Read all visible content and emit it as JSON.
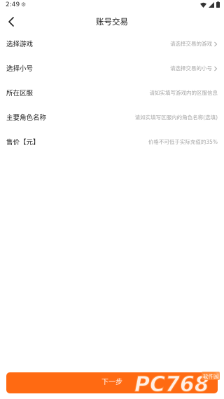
{
  "status": {
    "time": "2:49"
  },
  "header": {
    "title": "账号交易"
  },
  "rows": [
    {
      "label": "选择游戏",
      "value": "请选择交易的游戏",
      "has_chevron": true
    },
    {
      "label": "选择小号",
      "value": "请选择交易的小号",
      "has_chevron": true
    },
    {
      "label": "所在区服",
      "value": "请如实填写游戏内的区服信息",
      "has_chevron": false
    },
    {
      "label": "主要角色名称",
      "value": "请如实填写区服内的角色名称(选填)",
      "has_chevron": false
    },
    {
      "label": "售价【元】",
      "value": "价格不可低于实际充值的35%",
      "has_chevron": false
    }
  ],
  "footer": {
    "next_label": "下一步"
  },
  "watermark": {
    "text": "PC768",
    "sub": "软件园"
  },
  "colors": {
    "accent": "#ff6a12",
    "placeholder": "#a5a5a5"
  }
}
